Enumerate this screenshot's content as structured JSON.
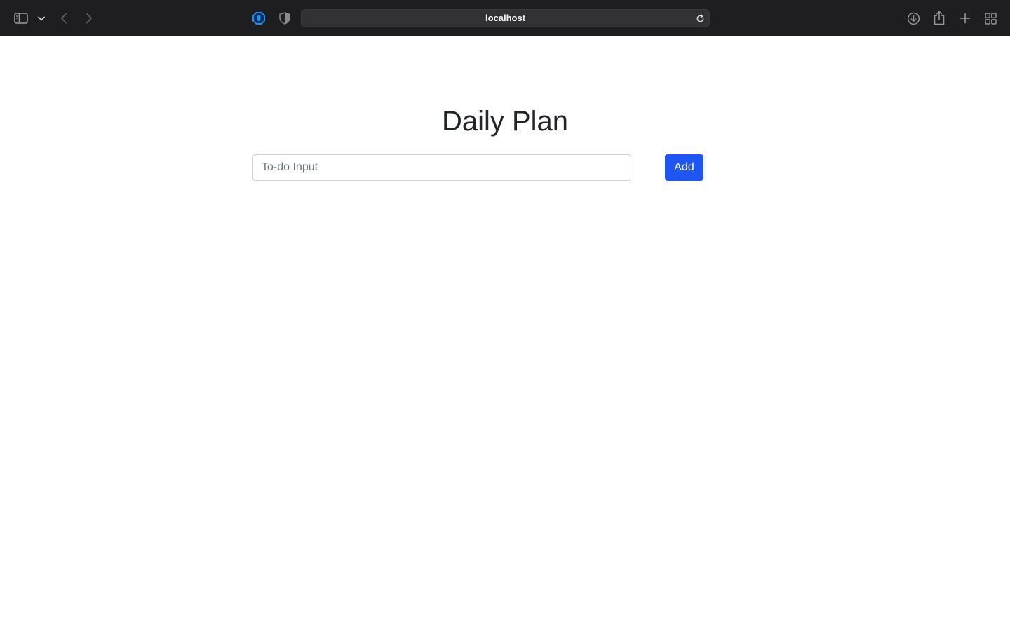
{
  "browser": {
    "url": "localhost",
    "icons": {
      "sidebar": "sidebar-icon",
      "tab_group_menu": "chevron-down-icon",
      "back": "chevron-left-icon",
      "forward": "chevron-right-icon",
      "extension": "shield-hand-icon",
      "privacy": "privacy-shield-icon",
      "reload": "reload-icon",
      "downloads": "download-icon",
      "share": "share-icon",
      "new_tab": "plus-icon",
      "tab_overview": "grid-icon"
    },
    "colors": {
      "toolbar_bg": "#1e1e20",
      "extension_accent": "#1d8ff0"
    }
  },
  "page": {
    "title": "Daily Plan",
    "input": {
      "placeholder": "To-do Input",
      "value": ""
    },
    "add_button_label": "Add",
    "colors": {
      "primary": "#1f55f0",
      "text": "#212529"
    }
  }
}
